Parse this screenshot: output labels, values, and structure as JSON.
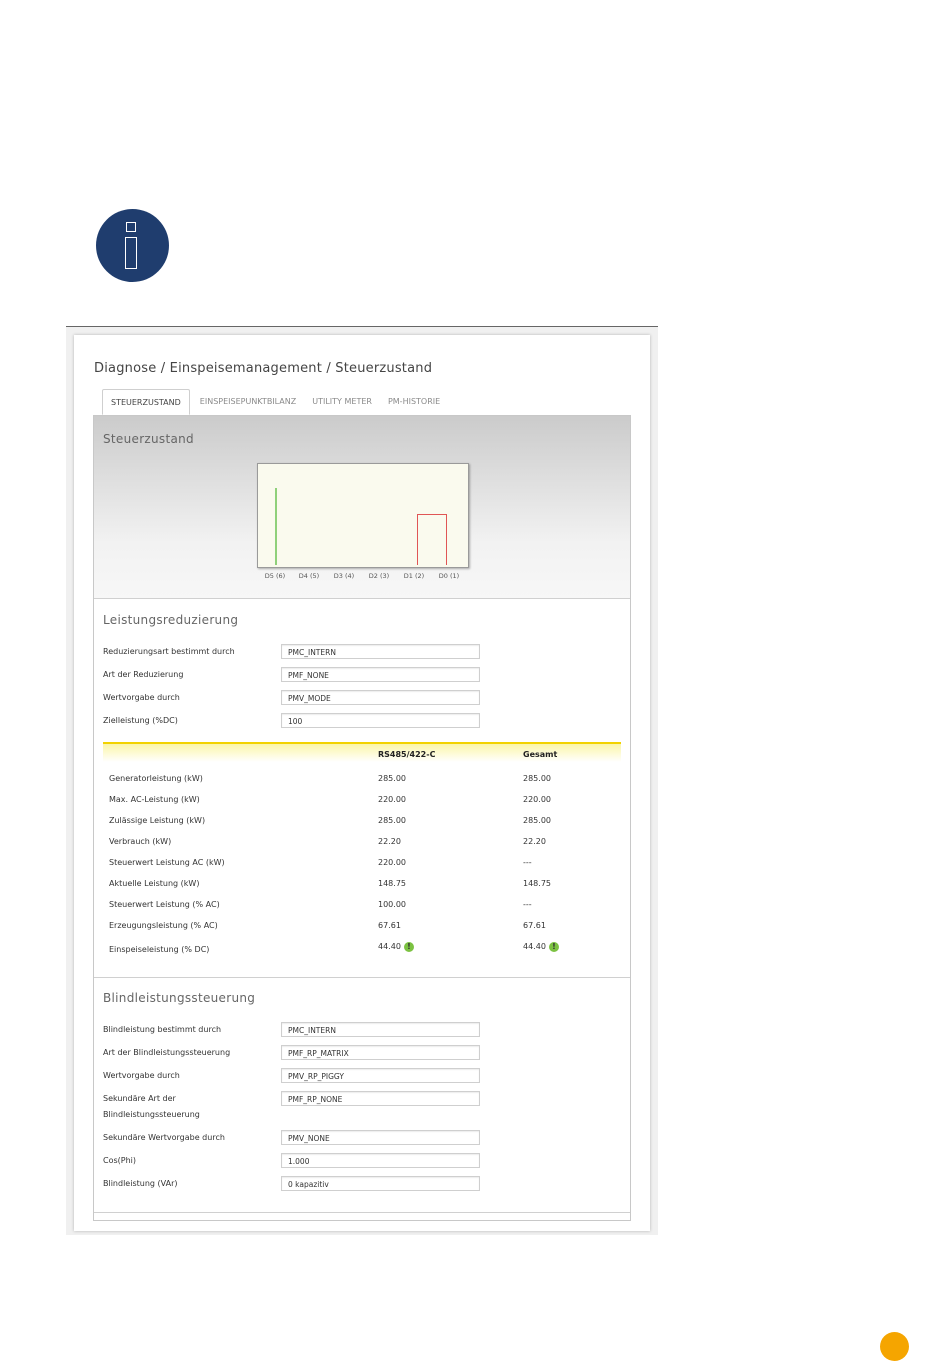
{
  "breadcrumb": "Diagnose / Einspeisemanagement / Steuerzustand",
  "tabs": [
    "STEUERZUSTAND",
    "EINSPEISEPUNKTBILANZ",
    "UTILITY METER",
    "PM-HISTORIE"
  ],
  "sections": {
    "chart_title": "Steuerzustand",
    "reduction_title": "Leistungsreduzierung",
    "reactive_title": "Blindleistungssteuerung"
  },
  "chart_data": {
    "type": "bar",
    "categories": [
      "D5 (6)",
      "D4 (5)",
      "D3 (4)",
      "D2 (3)",
      "D1 (2)",
      "D0 (1)"
    ],
    "series": [
      {
        "values": [
          1,
          0,
          0,
          0,
          0,
          0
        ],
        "color": "#8fd07a"
      },
      {
        "values": [
          0,
          0,
          0,
          0,
          0.66,
          0.66
        ],
        "color": "#e05555"
      }
    ]
  },
  "reduction": [
    {
      "label": "Reduzierungsart bestimmt durch",
      "value": "PMC_INTERN"
    },
    {
      "label": "Art der Reduzierung",
      "value": "PMF_NONE"
    },
    {
      "label": "Wertvorgabe durch",
      "value": "PMV_MODE"
    },
    {
      "label": "Zielleistung (%DC)",
      "value": "100"
    }
  ],
  "table": {
    "headers": [
      "",
      "RS485/422-C",
      "Gesamt"
    ],
    "rows": [
      [
        "Generatorleistung (kW)",
        "285.00",
        "285.00"
      ],
      [
        "Max. AC-Leistung (kW)",
        "220.00",
        "220.00"
      ],
      [
        "Zulässige Leistung (kW)",
        "285.00",
        "285.00"
      ],
      [
        "Verbrauch (kW)",
        "22.20",
        "22.20"
      ],
      [
        "Steuerwert Leistung AC (kW)",
        "220.00",
        "---"
      ],
      [
        "Aktuelle Leistung (kW)",
        "148.75",
        "148.75"
      ],
      [
        "Steuerwert Leistung (% AC)",
        "100.00",
        "---"
      ],
      [
        "Erzeugungsleistung (% AC)",
        "67.61",
        "67.61"
      ],
      [
        "Einspeiseleistung (% DC)",
        "44.40",
        "44.40"
      ]
    ],
    "status_glyph": "!",
    "status_color": "#7cc242"
  },
  "reactive": [
    {
      "label": "Blindleistung bestimmt durch",
      "value": "PMC_INTERN"
    },
    {
      "label": "Art der Blindleistungssteuerung",
      "value": "PMF_RP_MATRIX"
    },
    {
      "label": "Wertvorgabe durch",
      "value": "PMV_RP_PIGGY"
    },
    {
      "label": "Sekundäre Art der",
      "label2": "Blindleistungssteuerung",
      "value": "PMF_RP_NONE"
    },
    {
      "label": "Sekundäre Wertvorgabe durch",
      "value": "PMV_NONE"
    },
    {
      "label": "Cos(Phi)",
      "value": "1.000"
    },
    {
      "label": "Blindleistung (VAr)",
      "value": "0 kapazitiv"
    }
  ],
  "colors": {
    "info_icon": "#1f3d6e",
    "page_marker": "#f5a500",
    "table_header_accent": "#f2d200"
  }
}
